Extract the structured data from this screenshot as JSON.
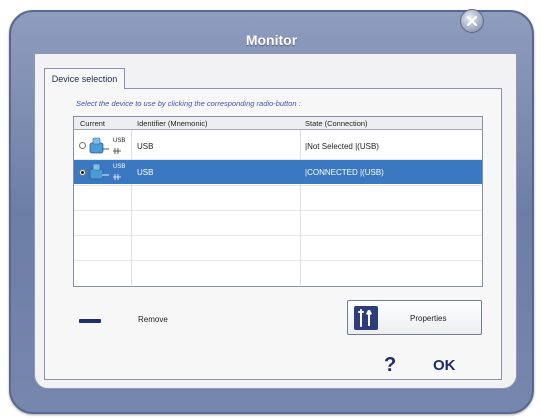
{
  "window": {
    "title": "Monitor"
  },
  "tabs": [
    {
      "label": "Device selection",
      "active": true
    }
  ],
  "instruction": "Select the device to use by clicking the corresponding radio-button :",
  "table": {
    "columns": [
      "Current",
      "Identifier (Mnemonic)",
      "State (Connection)"
    ],
    "rows": [
      {
        "selected": false,
        "icon_label": "USB",
        "identifier": "USB",
        "state": "|Not Selected |(USB)"
      },
      {
        "selected": true,
        "icon_label": "USB",
        "identifier": "USB",
        "state": "|CONNECTED |(USB)"
      }
    ]
  },
  "buttons": {
    "remove_label": "Remove",
    "properties_label": "Properties",
    "help_label": "?",
    "ok_label": "OK"
  },
  "icons": {
    "close": "close-icon",
    "usb_device": "usb-device-icon",
    "remove": "minus-icon",
    "properties": "wrench-screwdriver-icon"
  },
  "colors": {
    "window_frame": "#7686ad",
    "selection": "#3a79c2",
    "instruction_text": "#3f57b0",
    "button_text": "#1e2b6b"
  }
}
